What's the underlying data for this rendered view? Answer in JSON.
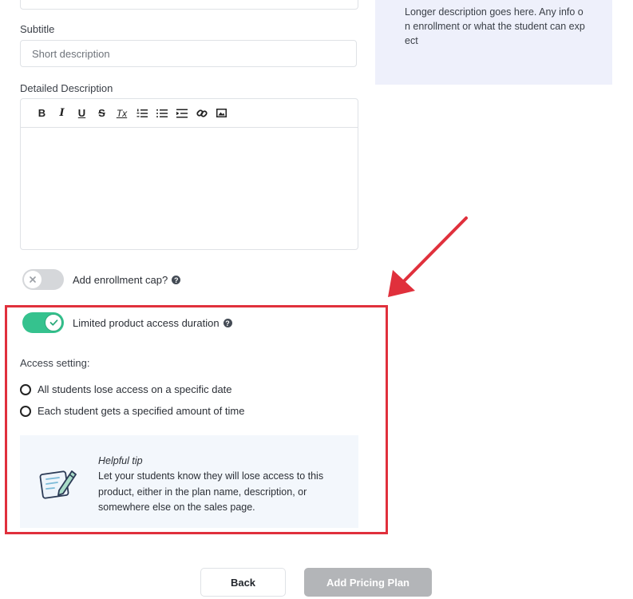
{
  "form": {
    "subtitle_label": "Subtitle",
    "subtitle_placeholder": "Short description",
    "detailed_description_label": "Detailed Description",
    "toolbar": [
      "B",
      "I",
      "U",
      "S",
      "Tx",
      "ordered-list",
      "bullet-list",
      "indent",
      "link",
      "image"
    ]
  },
  "preview": {
    "description_text": "Longer description goes here. Any info on enrollment or what the student can expect"
  },
  "toggles": {
    "enrollment_cap_label": "Add enrollment cap?",
    "enrollment_cap_on": false,
    "limited_access_label": "Limited product access duration",
    "limited_access_on": true
  },
  "access": {
    "heading": "Access setting:",
    "options": [
      "All students lose access on a specific date",
      "Each student gets a specified amount of time"
    ]
  },
  "tip": {
    "title": "Helpful tip",
    "body": "Let your students know they will lose access to this product, either in the plan name, description, or somewhere else on the sales page."
  },
  "actions": {
    "back_label": "Back",
    "add_label": "Add Pricing Plan"
  },
  "colors": {
    "toggle_on": "#35c28e",
    "annotation_red": "#e0303c",
    "preview_bg": "#eef0fb",
    "tip_bg": "#f3f7fc",
    "disabled_button": "#b3b5b8"
  }
}
